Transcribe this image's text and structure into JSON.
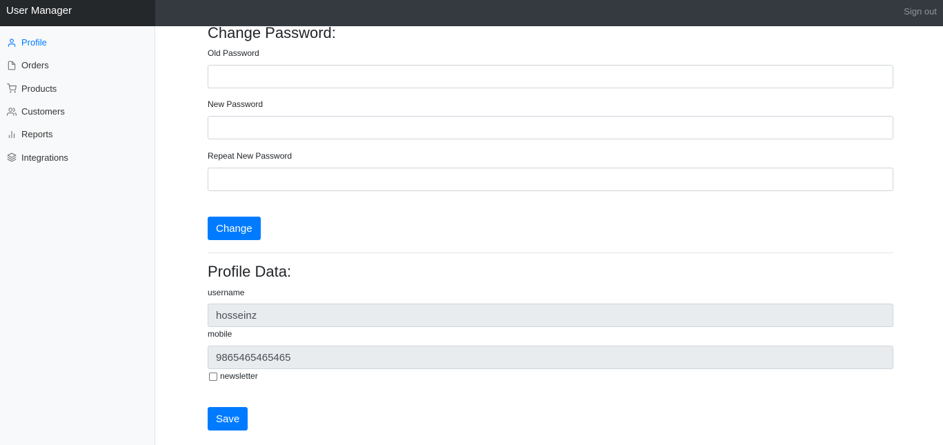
{
  "app": {
    "title": "User Manager",
    "sign_out": "Sign out"
  },
  "sidebar": {
    "items": [
      {
        "label": "Profile",
        "icon": "user-icon",
        "active": true
      },
      {
        "label": "Orders",
        "icon": "file-icon",
        "active": false
      },
      {
        "label": "Products",
        "icon": "shopping-cart-icon",
        "active": false
      },
      {
        "label": "Customers",
        "icon": "users-icon",
        "active": false
      },
      {
        "label": "Reports",
        "icon": "bar-chart-icon",
        "active": false
      },
      {
        "label": "Integrations",
        "icon": "layers-icon",
        "active": false
      }
    ]
  },
  "change_password": {
    "title": "Change Password:",
    "old_label": "Old Password",
    "new_label": "New Password",
    "repeat_label": "Repeat New Password",
    "old_value": "",
    "new_value": "",
    "repeat_value": "",
    "button": "Change"
  },
  "profile": {
    "title": "Profile Data:",
    "username_label": "username",
    "username_value": "hosseinz",
    "mobile_label": "mobile",
    "mobile_value": "9865465465465",
    "newsletter_label": "newsletter",
    "newsletter_checked": false,
    "button": "Save"
  },
  "colors": {
    "accent": "#007bff",
    "topbar": "#343a40",
    "sidebar_bg": "#f8f9fa"
  }
}
